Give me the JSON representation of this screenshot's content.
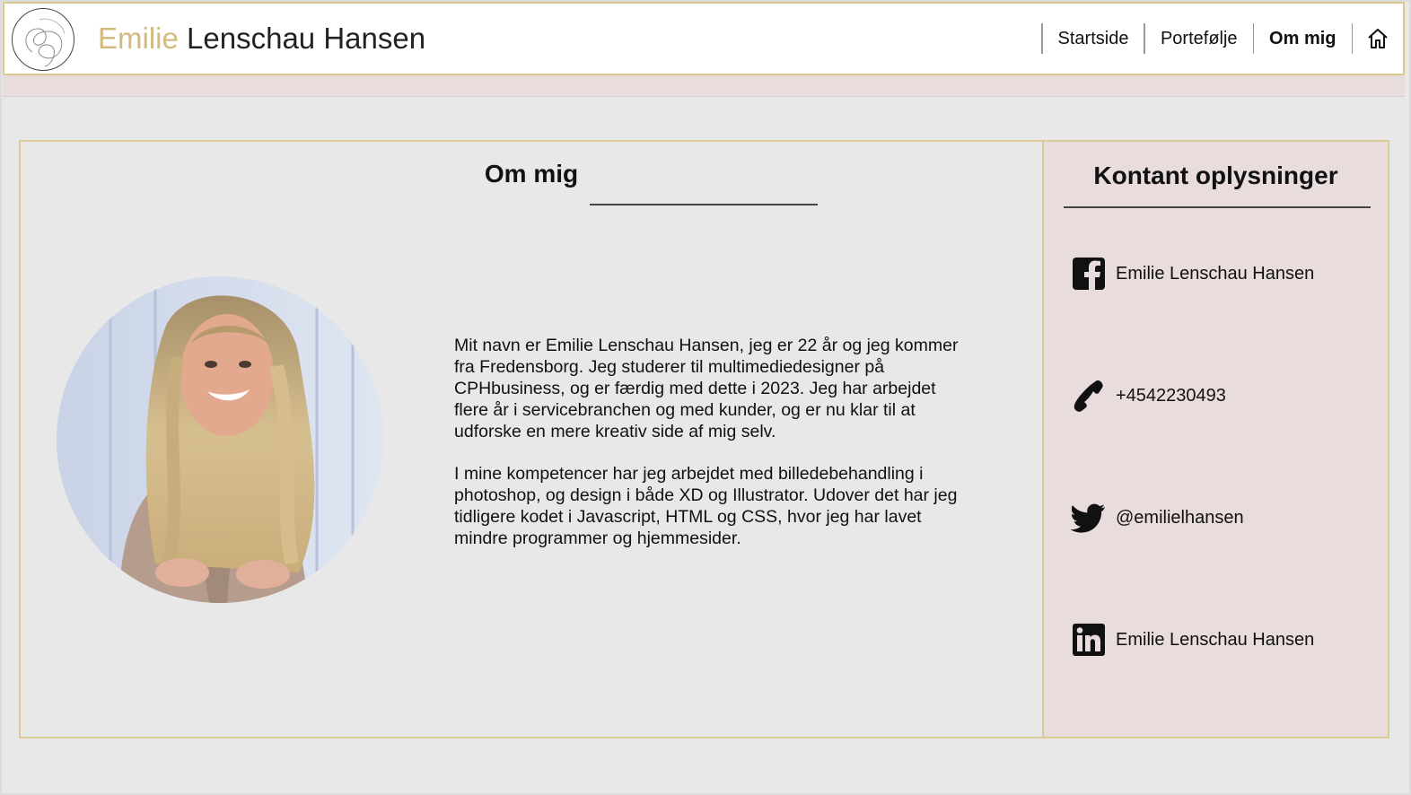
{
  "header": {
    "title_first": "Emilie",
    "title_rest": " Lenschau Hansen",
    "logo_icon": "logo-line-art-icon",
    "nav": [
      {
        "label": "Startside",
        "active": false
      },
      {
        "label": "Portefølje",
        "active": false
      },
      {
        "label": "Om mig",
        "active": true
      }
    ],
    "home_icon": "home-icon"
  },
  "main": {
    "title": "Om mig",
    "avatar_alt": "portrait-photo",
    "bio": [
      "Mit navn er Emilie Lenschau Hansen, jeg er 22 år og jeg kommer fra Fredensborg. Jeg studerer til multimediedesigner på CPHbusiness, og er færdig med dette i 2023. Jeg har arbejdet flere år i servicebranchen og med kunder, og er nu klar til at udforske en mere kreativ side af mig selv.",
      "I mine kompetencer har jeg arbejdet med billedebehandling i photoshop, og design i både XD og Illustrator. Udover det har jeg tidligere kodet i Javascript, HTML og CSS, hvor jeg har lavet mindre programmer og hjemmesider."
    ]
  },
  "sidebar": {
    "title": "Kontant oplysninger",
    "contacts": [
      {
        "icon": "facebook-icon",
        "label": "Emilie Lenschau Hansen"
      },
      {
        "icon": "phone-icon",
        "label": "+4542230493"
      },
      {
        "icon": "twitter-icon",
        "label": "@emilielhansen"
      },
      {
        "icon": "linkedin-icon",
        "label": "Emilie Lenschau Hansen"
      }
    ]
  },
  "colors": {
    "accent_gold": "#d3bb7d",
    "border_gold": "#dccb97",
    "sidebar_pink": "#e8dcdc",
    "page_bg": "#e8e8e8"
  }
}
